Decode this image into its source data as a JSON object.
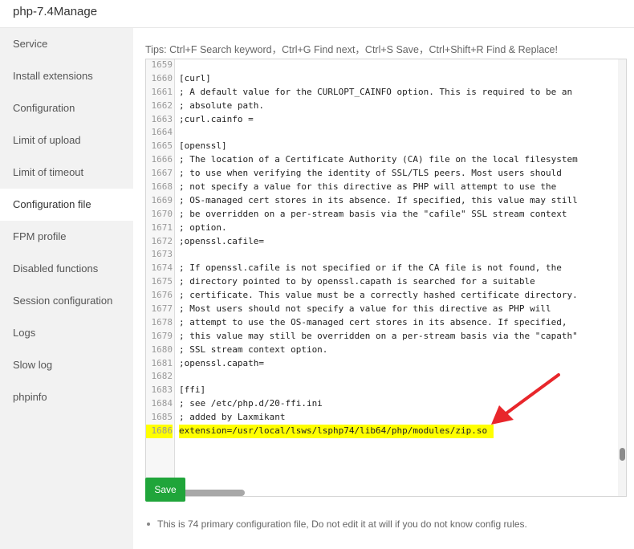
{
  "window": {
    "title": "php-7.4Manage"
  },
  "sidebar": {
    "items": [
      {
        "label": "Service"
      },
      {
        "label": "Install extensions"
      },
      {
        "label": "Configuration"
      },
      {
        "label": "Limit of upload"
      },
      {
        "label": "Limit of timeout"
      },
      {
        "label": "Configuration file",
        "active": true
      },
      {
        "label": "FPM profile"
      },
      {
        "label": "Disabled functions"
      },
      {
        "label": "Session configuration"
      },
      {
        "label": "Logs"
      },
      {
        "label": "Slow log"
      },
      {
        "label": "phpinfo"
      }
    ]
  },
  "main": {
    "tips": "Tips:  Ctrl+F Search keyword，Ctrl+G Find next，Ctrl+S Save，Ctrl+Shift+R Find & Replace!",
    "editor": {
      "highlighted_line": 1686,
      "lines": [
        {
          "n": "1659",
          "t": ""
        },
        {
          "n": "1660",
          "t": "[curl]"
        },
        {
          "n": "1661",
          "t": "; A default value for the CURLOPT_CAINFO option. This is required to be an"
        },
        {
          "n": "1662",
          "t": "; absolute path."
        },
        {
          "n": "1663",
          "t": ";curl.cainfo ="
        },
        {
          "n": "1664",
          "t": ""
        },
        {
          "n": "1665",
          "t": "[openssl]"
        },
        {
          "n": "1666",
          "t": "; The location of a Certificate Authority (CA) file on the local filesystem"
        },
        {
          "n": "1667",
          "t": "; to use when verifying the identity of SSL/TLS peers. Most users should"
        },
        {
          "n": "1668",
          "t": "; not specify a value for this directive as PHP will attempt to use the"
        },
        {
          "n": "1669",
          "t": "; OS-managed cert stores in its absence. If specified, this value may still"
        },
        {
          "n": "1670",
          "t": "; be overridden on a per-stream basis via the \"cafile\" SSL stream context"
        },
        {
          "n": "1671",
          "t": "; option."
        },
        {
          "n": "1672",
          "t": ";openssl.cafile="
        },
        {
          "n": "1673",
          "t": ""
        },
        {
          "n": "1674",
          "t": "; If openssl.cafile is not specified or if the CA file is not found, the"
        },
        {
          "n": "1675",
          "t": "; directory pointed to by openssl.capath is searched for a suitable"
        },
        {
          "n": "1676",
          "t": "; certificate. This value must be a correctly hashed certificate directory."
        },
        {
          "n": "1677",
          "t": "; Most users should not specify a value for this directive as PHP will"
        },
        {
          "n": "1678",
          "t": "; attempt to use the OS-managed cert stores in its absence. If specified,"
        },
        {
          "n": "1679",
          "t": "; this value may still be overridden on a per-stream basis via the \"capath\""
        },
        {
          "n": "1680",
          "t": "; SSL stream context option."
        },
        {
          "n": "1681",
          "t": ";openssl.capath="
        },
        {
          "n": "1682",
          "t": ""
        },
        {
          "n": "1683",
          "t": "[ffi]"
        },
        {
          "n": "1684",
          "t": "; see /etc/php.d/20-ffi.ini"
        },
        {
          "n": "1685",
          "t": "; added by Laxmikant"
        },
        {
          "n": "1686",
          "t": "extension=/usr/local/lsws/lsphp74/lib64/php/modules/zip.so"
        }
      ]
    },
    "save_label": "Save",
    "note": "This is 74 primary configuration file, Do not edit it at will if you do not know config rules."
  },
  "colors": {
    "accent": "#20a53a",
    "highlight": "#ffff00",
    "arrow": "#e8262b",
    "sidebar_bg": "#f2f2f2"
  },
  "icons": {
    "annotation": "red-arrow-icon",
    "close": "close-icon"
  }
}
